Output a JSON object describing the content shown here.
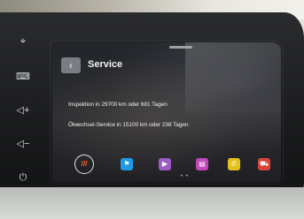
{
  "header": {
    "back_icon": "chevron-left-icon",
    "title": "Service"
  },
  "content": {
    "lines": [
      "Inspektion in 29700 km oder 681 Tagen",
      "Ölwechsel-Service in 15100 km oder 238 Tagen"
    ]
  },
  "dock": {
    "home_label": "///",
    "items": [
      {
        "icon": "flag-icon",
        "glyph": "⚑",
        "color": "#1f9be6"
      },
      {
        "icon": "play-icon",
        "glyph": "▶",
        "color": "#9b5cc7"
      },
      {
        "icon": "media-icon",
        "glyph": "▤",
        "color": "#c247b8"
      },
      {
        "icon": "phone-icon",
        "glyph": "✆",
        "color": "#e2c21a"
      },
      {
        "icon": "car-icon",
        "glyph": "⛟",
        "color": "#d7433a"
      }
    ],
    "page_dots": "• •"
  },
  "side_controls": [
    {
      "icon": "navigation-icon",
      "glyph": "⌖"
    },
    {
      "icon": "keyboard-icon",
      "glyph": "⌨"
    },
    {
      "icon": "volume-up-icon",
      "glyph": "◁+"
    },
    {
      "icon": "volume-down-icon",
      "glyph": "◁−"
    },
    {
      "icon": "power-icon",
      "glyph": "⏻"
    }
  ]
}
